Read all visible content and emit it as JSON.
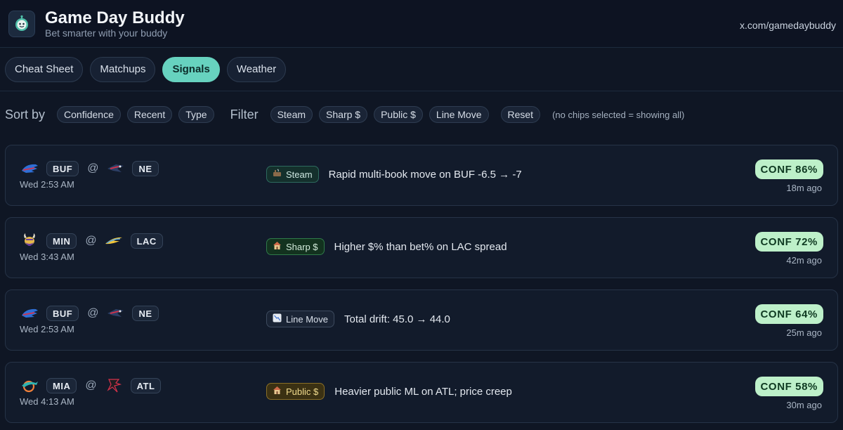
{
  "header": {
    "title": "Game Day Buddy",
    "subtitle": "Bet smarter with your buddy",
    "handle": "x.com/gamedaybuddy"
  },
  "tabs": [
    {
      "label": "Cheat Sheet",
      "active": false
    },
    {
      "label": "Matchups",
      "active": false
    },
    {
      "label": "Signals",
      "active": true
    },
    {
      "label": "Weather",
      "active": false
    }
  ],
  "filters": {
    "sort_label": "Sort by",
    "sort_options": [
      "Confidence",
      "Recent",
      "Type"
    ],
    "filter_label": "Filter",
    "filter_chips": [
      "Steam",
      "Sharp $",
      "Public $",
      "Line Move"
    ],
    "reset_label": "Reset",
    "note": "(no chips selected = showing all)"
  },
  "signals": [
    {
      "away": "BUF",
      "away_icon": "bills-icon",
      "home": "NE",
      "home_icon": "patriots-icon",
      "time": "Wed 2:53 AM",
      "type": "Steam",
      "type_icon": "steam-icon",
      "text": "Rapid multi-book move on BUF -6.5 → -7",
      "conf": "CONF 86%",
      "ago": "18m ago"
    },
    {
      "away": "MIN",
      "away_icon": "vikings-icon",
      "home": "LAC",
      "home_icon": "chargers-icon",
      "time": "Wed 3:43 AM",
      "type": "Sharp $",
      "type_icon": "house-icon",
      "text": "Higher $% than bet% on LAC spread",
      "conf": "CONF 72%",
      "ago": "42m ago"
    },
    {
      "away": "BUF",
      "away_icon": "bills-icon",
      "home": "NE",
      "home_icon": "patriots-icon",
      "time": "Wed 2:53 AM",
      "type": "Line Move",
      "type_icon": "chart-down-icon",
      "text": "Total drift: 45.0 → 44.0",
      "conf": "CONF 64%",
      "ago": "25m ago"
    },
    {
      "away": "MIA",
      "away_icon": "dolphins-icon",
      "home": "ATL",
      "home_icon": "falcons-icon",
      "time": "Wed 4:13 AM",
      "type": "Public $",
      "type_icon": "house-icon",
      "text": "Heavier public ML on ATL; price creep",
      "conf": "CONF 58%",
      "ago": "30m ago"
    }
  ],
  "colors": {
    "accent": "#67d2bf",
    "conf_bg": "#bdf0c9",
    "background": "#0f1624"
  }
}
